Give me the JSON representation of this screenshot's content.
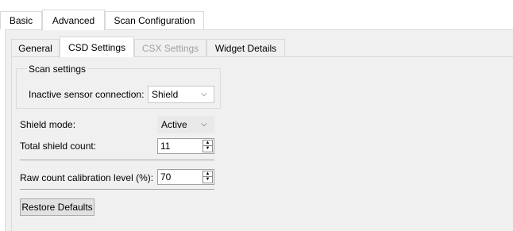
{
  "top_tabs": [
    {
      "label": "Basic"
    },
    {
      "label": "Advanced",
      "selected": true
    },
    {
      "label": "Scan Configuration"
    }
  ],
  "inner_tabs": [
    {
      "label": "General"
    },
    {
      "label": "CSD Settings",
      "selected": true
    },
    {
      "label": "CSX Settings",
      "disabled": true
    },
    {
      "label": "Widget Details"
    }
  ],
  "scan_settings": {
    "title": "Scan settings",
    "inactive_sensor_label": "Inactive sensor connection:",
    "inactive_sensor_value": "Shield"
  },
  "shield_mode": {
    "label": "Shield mode:",
    "value": "Active"
  },
  "total_shield_count": {
    "label": "Total shield count:",
    "value": "11"
  },
  "raw_count_calibration": {
    "label": "Raw count calibration level (%):",
    "value": "70"
  },
  "restore_defaults_label": "Restore Defaults"
}
